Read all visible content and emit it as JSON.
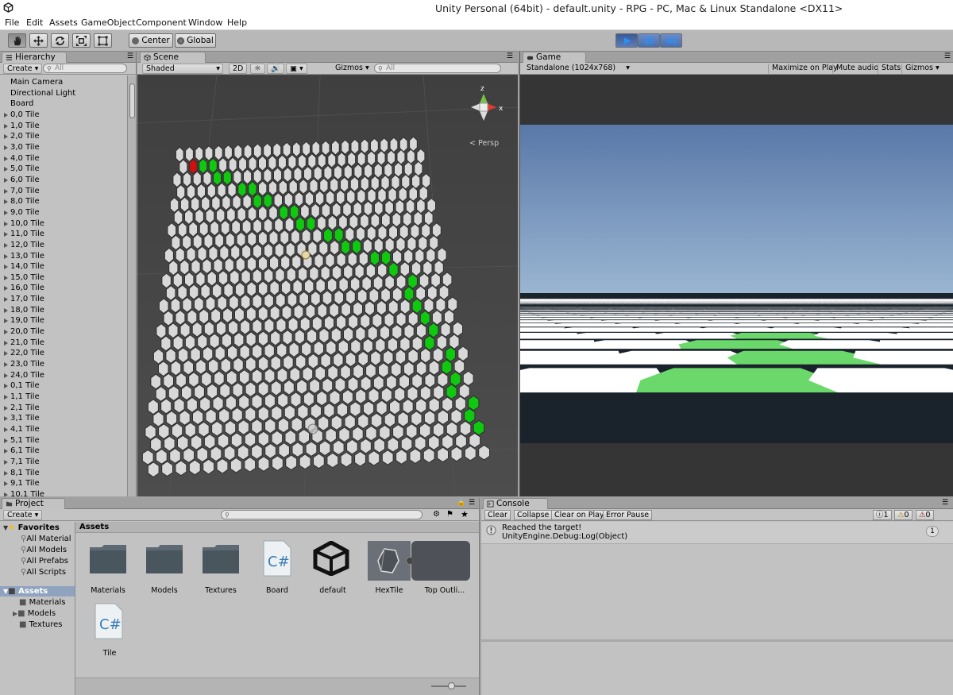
{
  "window": {
    "title": "Unity Personal (64bit) - default.unity - RPG - PC, Mac & Linux Standalone <DX11>"
  },
  "menu": [
    "File",
    "Edit",
    "Assets",
    "GameObject",
    "Component",
    "Window",
    "Help"
  ],
  "toolbar": {
    "pivot": "Center",
    "space": "Global"
  },
  "hierarchy": {
    "tab": "Hierarchy",
    "create": "Create",
    "search_placeholder": "All",
    "items": [
      "Main Camera",
      "Directional Light",
      "Board",
      "0,0 Tile",
      "1,0 Tile",
      "2,0 Tile",
      "3,0 Tile",
      "4,0 Tile",
      "5,0 Tile",
      "6,0 Tile",
      "7,0 Tile",
      "8,0 Tile",
      "9,0 Tile",
      "10,0 Tile",
      "11,0 Tile",
      "12,0 Tile",
      "13,0 Tile",
      "14,0 Tile",
      "15,0 Tile",
      "16,0 Tile",
      "17,0 Tile",
      "18,0 Tile",
      "19,0 Tile",
      "20,0 Tile",
      "21,0 Tile",
      "22,0 Tile",
      "23,0 Tile",
      "24,0 Tile",
      "0,1 Tile",
      "1,1 Tile",
      "2,1 Tile",
      "3,1 Tile",
      "4,1 Tile",
      "5,1 Tile",
      "6,1 Tile",
      "7,1 Tile",
      "8,1 Tile",
      "9,1 Tile",
      "10,1 Tile"
    ]
  },
  "scene": {
    "tab": "Scene",
    "shading": "Shaded",
    "mode2d": "2D",
    "gizmos": "Gizmos",
    "search_placeholder": "All",
    "persp_label": "Persp",
    "axis_y": "z",
    "axis_x": "x"
  },
  "game": {
    "tab": "Game",
    "resolution": "Standalone (1024x768)",
    "maximize": "Maximize on Play",
    "mute": "Mute audio",
    "stats": "Stats",
    "gizmos": "Gizmos"
  },
  "project": {
    "tab": "Project",
    "create": "Create",
    "favorites_label": "Favorites",
    "favorites": [
      "All Material",
      "All Models",
      "All Prefabs",
      "All Scripts"
    ],
    "assets_root": "Assets",
    "folders": [
      "Materials",
      "Models",
      "Textures"
    ],
    "assets_header": "Assets",
    "assets": [
      {
        "name": "Materials",
        "icon": "folder-icon"
      },
      {
        "name": "Models",
        "icon": "folder-icon"
      },
      {
        "name": "Textures",
        "icon": "folder-icon"
      },
      {
        "name": "Board",
        "icon": "csharp-script-icon"
      },
      {
        "name": "default",
        "icon": "unity-scene-icon"
      },
      {
        "name": "HexTile",
        "icon": "hex-prefab-icon"
      },
      {
        "name": "Top Outli...",
        "icon": "prefab-child-icon"
      },
      {
        "name": "Tile",
        "icon": "csharp-script-icon"
      }
    ]
  },
  "console": {
    "tab": "Console",
    "buttons": [
      "Clear",
      "Collapse",
      "Clear on Play",
      "Error Pause"
    ],
    "counts": {
      "info": "1",
      "warn": "0",
      "error": "0"
    },
    "message_line1": "Reached the target!",
    "message_line2": "UnityEngine.Debug:Log(Object)",
    "message_count": "1"
  },
  "colors": {
    "path": "#10c810",
    "target": "#d01010",
    "tile": "#d8d8d8",
    "sky_top": "#5577aa",
    "sky_bottom": "#dde8ee"
  }
}
